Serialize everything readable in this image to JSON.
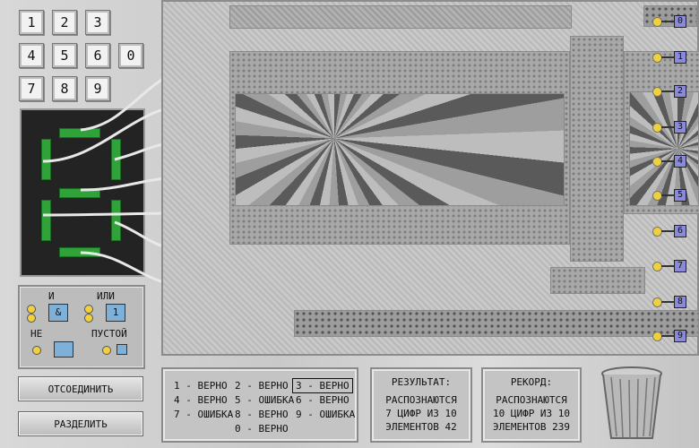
{
  "keypad": [
    "1",
    "2",
    "3",
    "4",
    "5",
    "6",
    "0",
    "7",
    "8",
    "9"
  ],
  "gates": {
    "and_label": "И",
    "or_label": "ИЛИ",
    "not_label": "НЕ",
    "empty_label": "ПУСТОЙ",
    "and_symbol": "&",
    "or_symbol": "1"
  },
  "buttons": {
    "disconnect": "ОТСОЕДИНИТЬ",
    "split": "РАЗДЕЛИТЬ"
  },
  "outputs": [
    "0",
    "1",
    "2",
    "3",
    "4",
    "5",
    "6",
    "7",
    "8",
    "9"
  ],
  "results": [
    "1 - ВЕРНО",
    "2 - ВЕРНО",
    "3 - ВЕРНО",
    "4 - ВЕРНО",
    "5 - ОШИБКА",
    "6 - ВЕРНО",
    "7 - ОШИБКА",
    "8 - ВЕРНО",
    "9 - ОШИБКА",
    "0 - ВЕРНО"
  ],
  "score": {
    "title": "РЕЗУЛЬТАТ:",
    "line1": "РАСПОЗНАЮТСЯ",
    "line2": "7 ЦИФР ИЗ 10",
    "line3": "ЭЛЕМЕНТОВ 42"
  },
  "record": {
    "title": "РЕКОРД:",
    "line1": "РАСПОЗНАЮТСЯ",
    "line2": "10 ЦИФР ИЗ 10",
    "line3": "ЭЛЕМЕНТОВ 239"
  },
  "colors": {
    "segment": "#2fa33a",
    "terminal": "#3f9a3f",
    "output_box": "#8a8ad8",
    "output_dot": "#f0d040"
  }
}
